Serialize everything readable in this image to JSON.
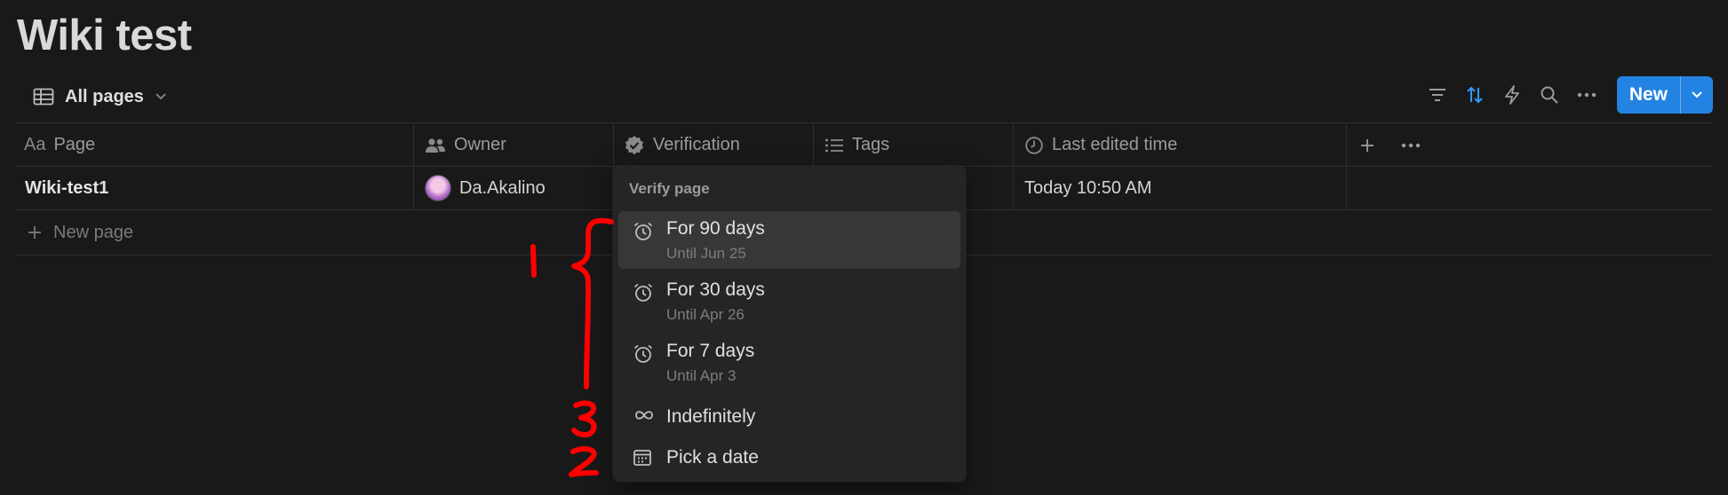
{
  "page": {
    "title": "Wiki test"
  },
  "view": {
    "label": "All pages"
  },
  "toolbar": {
    "new_label": "New"
  },
  "table": {
    "columns": [
      {
        "label": "Page",
        "icon": "aa-text-icon"
      },
      {
        "label": "Owner",
        "icon": "people-icon"
      },
      {
        "label": "Verification",
        "icon": "verified-badge-icon"
      },
      {
        "label": "Tags",
        "icon": "list-icon"
      },
      {
        "label": "Last edited time",
        "icon": "clock-icon"
      }
    ],
    "rows": [
      {
        "page": "Wiki-test1",
        "owner": "Da.Akalino",
        "last_edited": "Today 10:50 AM"
      }
    ],
    "new_page_label": "New page",
    "page_icon_text": "Aa"
  },
  "menu": {
    "header": "Verify page",
    "items": [
      {
        "label": "For 90 days",
        "sub": "Until Jun 25",
        "icon": "alarm-clock-icon",
        "active": true
      },
      {
        "label": "For 30 days",
        "sub": "Until Apr 26",
        "icon": "alarm-clock-icon"
      },
      {
        "label": "For 7 days",
        "sub": "Until Apr 3",
        "icon": "alarm-clock-icon"
      },
      {
        "label": "Indefinitely",
        "icon": "infinity-icon"
      },
      {
        "label": "Pick a date",
        "icon": "calendar-icon"
      }
    ]
  },
  "annotations": {
    "marks": [
      "1",
      "3",
      "2"
    ],
    "color": "#ff0000"
  },
  "colors": {
    "accent": "#2383e2",
    "background": "#191919",
    "menu_bg": "#252525"
  }
}
